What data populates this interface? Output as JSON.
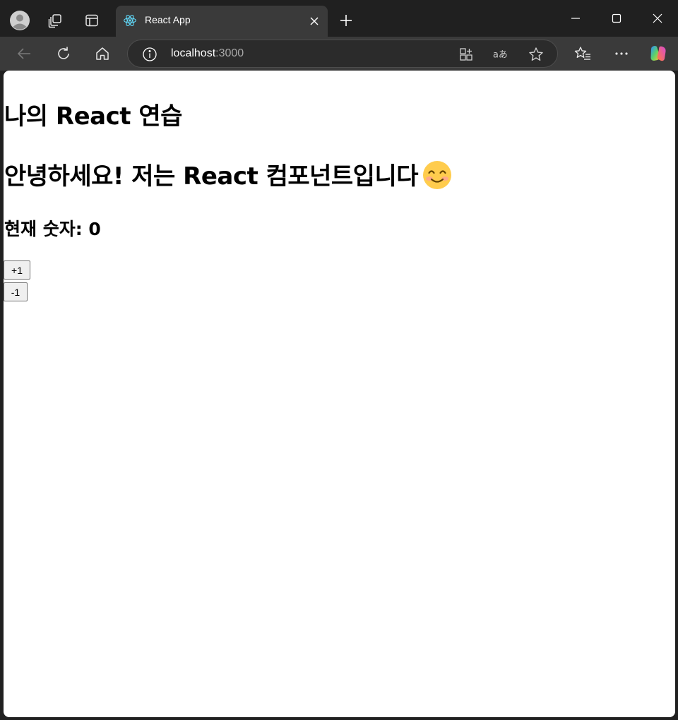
{
  "browser": {
    "tab": {
      "title": "React App"
    },
    "address": {
      "host": "localhost",
      "port": ":3000"
    }
  },
  "page": {
    "title": "나의 React 연습",
    "greeting": "안녕하세요! 저는 React 컴포넌트입니다",
    "counter_label": "현재 숫자: 0",
    "increment_label": "+1",
    "decrement_label": "-1"
  },
  "colors": {
    "chrome_dark": "#202020",
    "toolbar": "#3a3a3a",
    "page_bg": "#ffffff",
    "react_blue": "#61dafb"
  }
}
